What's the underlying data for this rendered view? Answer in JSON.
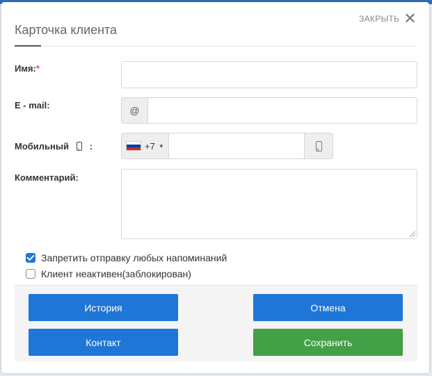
{
  "dialog": {
    "close_label": "ЗАКРЫТЬ",
    "title": "Карточка клиента"
  },
  "form": {
    "name_label": "Имя:",
    "required_mark": "*",
    "email_label": "E - mail:",
    "email_addon": "@",
    "mobile_label": "Мобильный",
    "mobile_label_suffix": ":",
    "phone_country_code": "+7",
    "phone_country_flag": "russia-flag-icon",
    "comment_label": "Комментарий:",
    "name_value": "",
    "email_value": "",
    "phone_value": "",
    "comment_value": ""
  },
  "checkboxes": [
    {
      "label": "Запретить отправку любых напоминаний",
      "checked": true
    },
    {
      "label": "Клиент неактивен(заблокирован)",
      "checked": false
    }
  ],
  "buttons": {
    "history": "История",
    "cancel": "Отмена",
    "contact": "Контакт",
    "save": "Сохранить"
  },
  "colors": {
    "primary": "#1e76d6",
    "success": "#43a047",
    "required": "#d9534f"
  }
}
